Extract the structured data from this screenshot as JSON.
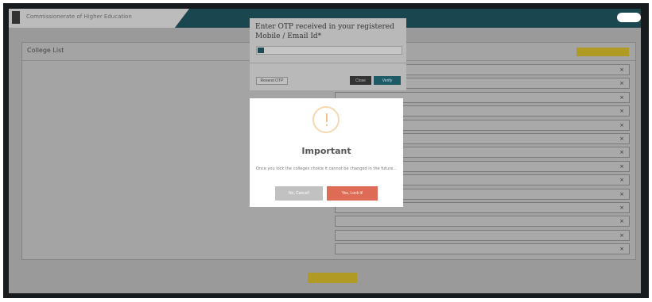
{
  "header": {
    "app_title": "Commissionerate of Higher Education"
  },
  "card": {
    "title": "College List",
    "choose_label": ""
  },
  "colleges": [
    {
      "name": ""
    },
    {
      "name": ""
    },
    {
      "name": ""
    },
    {
      "name": ""
    },
    {
      "name": ""
    },
    {
      "name": ""
    },
    {
      "name": ""
    },
    {
      "name": ""
    },
    {
      "name": ""
    },
    {
      "name": ""
    },
    {
      "name": ""
    },
    {
      "name": ""
    },
    {
      "name": ""
    },
    {
      "name": ""
    }
  ],
  "submit_label": "",
  "otp_dialog": {
    "title": "Enter OTP received in your registered Mobile / Email Id*",
    "input_value": "",
    "input_placeholder": "",
    "resend_label": "Resend OTP",
    "close_label": "Close",
    "verify_label": "Verify"
  },
  "important_modal": {
    "title": "Important",
    "message": "Once you lock the colleges choice it cannot be changed in the future...",
    "cancel_label": "No, Cancel!",
    "confirm_label": "Yes, Lock it!"
  },
  "colors": {
    "topbar": "#1a4650",
    "accent": "#b09a24",
    "danger": "#dd6b55"
  }
}
